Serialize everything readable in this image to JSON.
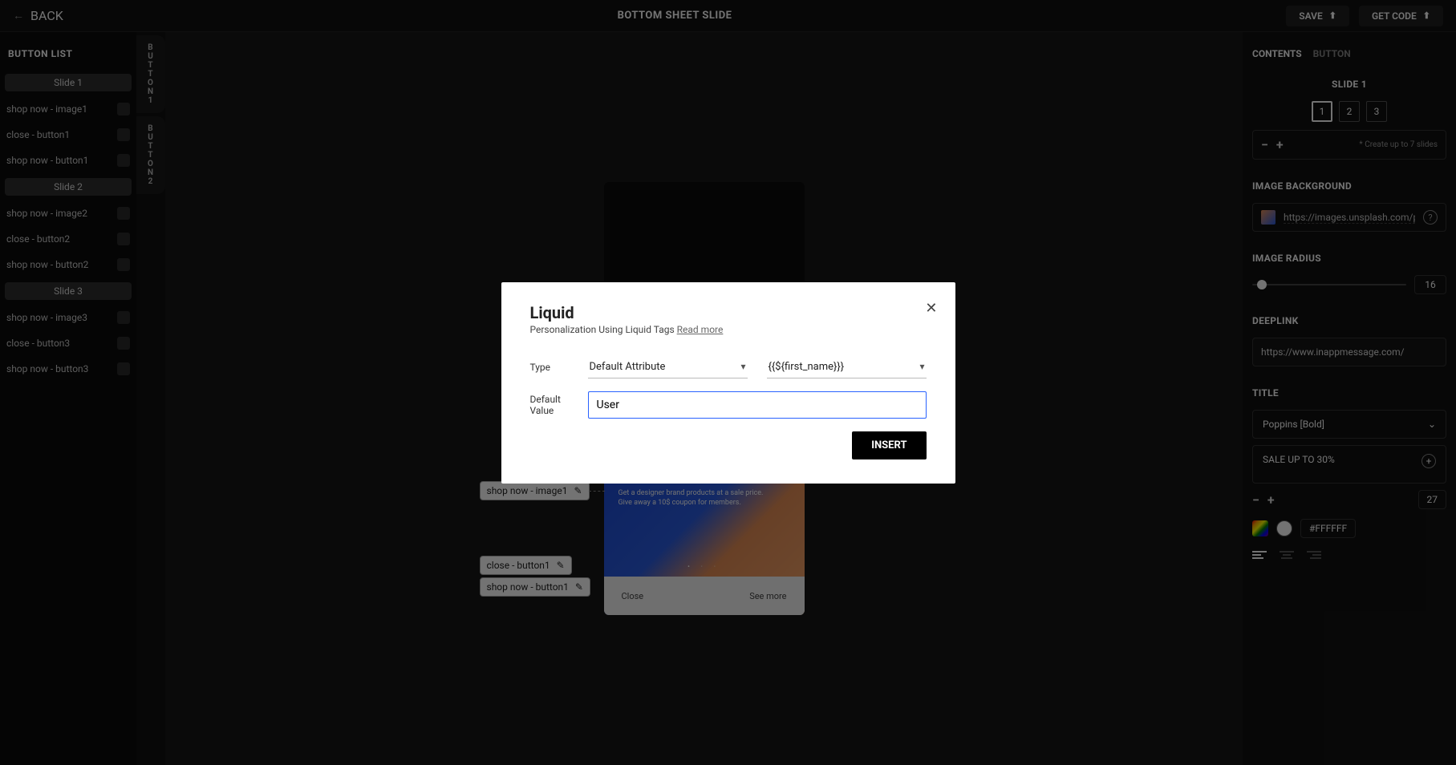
{
  "topbar": {
    "back_label": "BACK",
    "title": "BOTTOM SHEET SLIDE",
    "save_label": "SAVE",
    "get_code_label": "GET CODE"
  },
  "left": {
    "heading": "BUTTON LIST",
    "groups": [
      {
        "header": "Slide 1",
        "items": [
          "shop now - image1",
          "close - button1",
          "shop now - button1"
        ]
      },
      {
        "header": "Slide 2",
        "items": [
          "shop now - image2",
          "close - button2",
          "shop now - button2"
        ]
      },
      {
        "header": "Slide 3",
        "items": [
          "shop now - image3",
          "close - button3",
          "shop now - button3"
        ]
      }
    ]
  },
  "sidetabs": [
    "BUTTON1",
    "BUTTON2"
  ],
  "canvas": {
    "sheet_line1": "Get a designer brand products at a sale price.",
    "sheet_line2": "Give away a 10$ coupon for members.",
    "footer_close": "Close",
    "footer_more": "See more",
    "ann1": "shop now - image1",
    "ann2": "close - button1",
    "ann3": "shop now - button1"
  },
  "right": {
    "tab_contents": "CONTENTS",
    "tab_button": "BUTTON",
    "slide_label": "SLIDE 1",
    "slides": [
      "1",
      "2",
      "3"
    ],
    "slide_note": "* Create up to 7 slides",
    "imgbg_label": "IMAGE BACKGROUND",
    "imgbg_value": "https://images.unsplash.com/photo-…",
    "img_radius_label": "IMAGE RADIUS",
    "img_radius_value": "16",
    "deeplink_label": "DEEPLINK",
    "deeplink_value": "https://www.inappmessage.com/",
    "title_label": "TITLE",
    "font_value": "Poppins [Bold]",
    "title_text": "SALE UP TO 30%",
    "title_size": "27",
    "title_color": "#FFFFFF"
  },
  "modal": {
    "title": "Liquid",
    "subtitle": "Personalization Using Liquid Tags ",
    "readmore": "Read more",
    "type_label": "Type",
    "type_value": "Default Attribute",
    "attr_value": "{{${first_name}}}",
    "default_label": "Default Value",
    "default_input": "User",
    "insert_label": "INSERT"
  }
}
